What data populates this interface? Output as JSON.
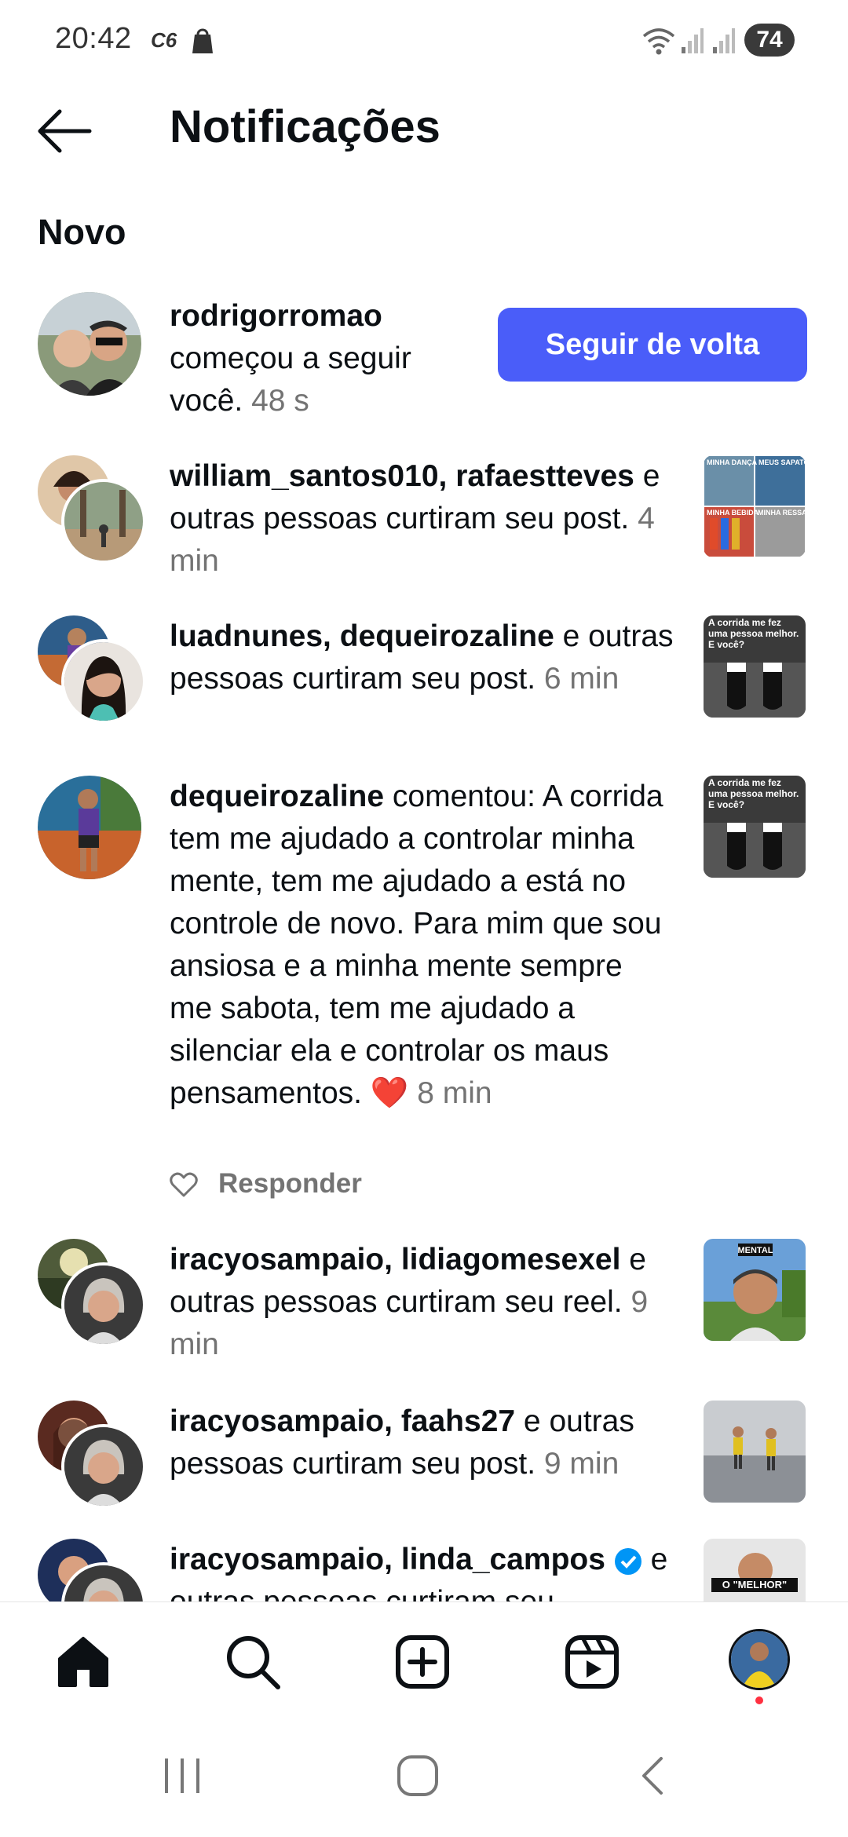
{
  "status_bar": {
    "time": "20:42",
    "carrier": "C6",
    "battery": "74"
  },
  "header": {
    "title": "Notificações",
    "back_icon": "arrow-left-icon"
  },
  "section_title": "Novo",
  "notifications": [
    {
      "users": [
        "rodrigorromao"
      ],
      "text": " começou a seguir você.",
      "time": "48 s",
      "action": "Seguir de volta"
    },
    {
      "users": [
        "william_santos010",
        "rafaestteves"
      ],
      "text": " e outras pessoas curtiram seu post.",
      "time": "4 min"
    },
    {
      "users": [
        "luadnunes",
        "dequeirozaline"
      ],
      "text": " e outras pessoas curtiram seu post.",
      "time": "6 min"
    },
    {
      "users": [
        "dequeirozaline"
      ],
      "text": " comentou: A corrida tem me ajudado a controlar minha mente, tem me ajudado a está no controle de novo. Para mim que sou ansiosa e a minha mente sempre me sabota, tem me ajudado a silenciar ela e controlar os maus pensamentos. ❤️",
      "time": "8 min",
      "reply_label": "Responder"
    },
    {
      "users": [
        "iracyosampaio",
        "lidiagomesexel"
      ],
      "text": " e outras pessoas curtiram seu reel.",
      "time": "9 min"
    },
    {
      "users": [
        "iracyosampaio",
        "faahs27"
      ],
      "text": " e outras pessoas curtiram seu post.",
      "time": "9 min"
    },
    {
      "users": [
        "iracyosampaio",
        "linda_campos"
      ],
      "text": " e outras pessoas curtiram seu",
      "time": ""
    }
  ],
  "thumb_texts": {
    "t1a": "MINHA DANÇA",
    "t1b": "MEUS SAPATOS",
    "t1c": "MINHA BEBIDA",
    "t1d": "MINHA RESSACA",
    "t2": "A corrida me fez uma pessoa melhor. E você?",
    "t3": "A corrida me fez uma pessoa melhor. E você?",
    "t4": "MENTAL",
    "t6": "O \"MELHOR\""
  },
  "bottom_nav": [
    "home-icon",
    "search-icon",
    "create-icon",
    "reels-icon",
    "profile-avatar"
  ],
  "colors": {
    "accent": "#4a5df9",
    "time_gray": "#737373",
    "notification_dot": "#ff3040"
  }
}
